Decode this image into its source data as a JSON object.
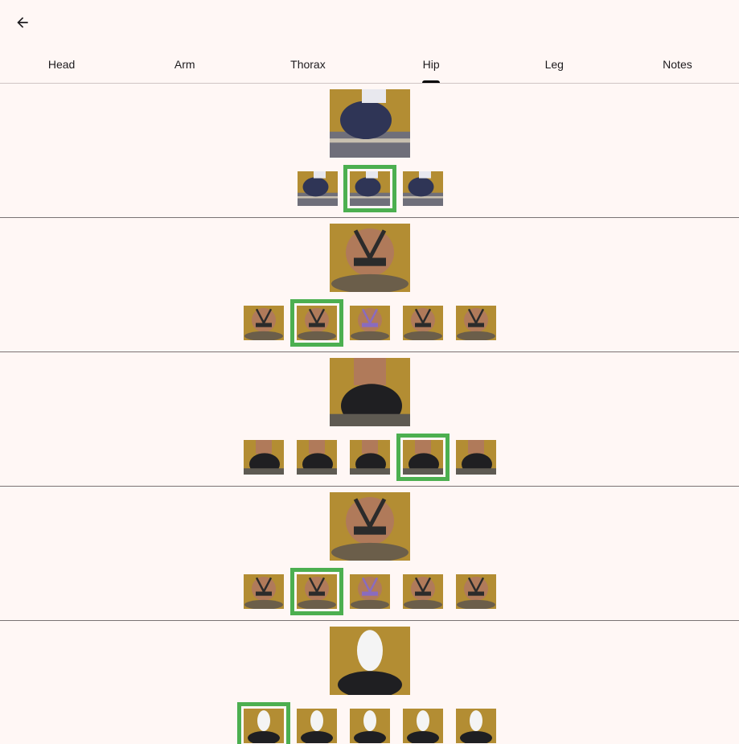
{
  "header": {
    "back_icon": "arrow-back-icon"
  },
  "tabs": [
    {
      "label": "Head",
      "active": false
    },
    {
      "label": "Arm",
      "active": false
    },
    {
      "label": "Thorax",
      "active": false
    },
    {
      "label": "Hip",
      "active": true
    },
    {
      "label": "Leg",
      "active": false
    },
    {
      "label": "Notes",
      "active": false
    }
  ],
  "colors": {
    "background": "#fff7f5",
    "photo_background": "#b38d33",
    "selected_outline": "#4caf50",
    "divider": "#7a7373"
  },
  "sections": [
    {
      "main": "side-seated-legs",
      "thumbs": [
        "side-legs-a",
        "side-legs-b",
        "side-legs-c"
      ],
      "selected_index": 1
    },
    {
      "main": "rear-torso",
      "thumbs": [
        "rear-a",
        "rear-b",
        "rear-purple",
        "rear-c",
        "rear-d"
      ],
      "selected_index": 1
    },
    {
      "main": "rear-hips",
      "thumbs": [
        "hips-a",
        "hips-b",
        "hips-c",
        "hips-d",
        "hips-e"
      ],
      "selected_index": 3
    },
    {
      "main": "rear-torso-wide",
      "thumbs": [
        "rear-w-a",
        "rear-w-b",
        "rear-w-purple",
        "rear-w-c",
        "rear-w-d"
      ],
      "selected_index": 1
    },
    {
      "main": "side-torso-white",
      "thumbs": [
        "side-w-a",
        "side-w-b",
        "side-w-c",
        "side-w-d",
        "side-w-e"
      ],
      "selected_index": 0
    }
  ]
}
